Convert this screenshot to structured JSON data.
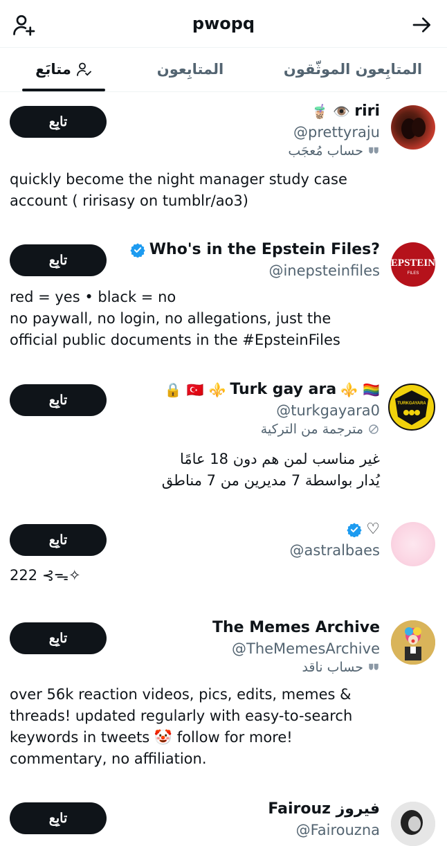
{
  "header": {
    "title": "pwopq",
    "add_user_icon": "add-user-icon",
    "forward_icon": "arrow-right-icon"
  },
  "tabs": [
    {
      "label": "المتابِعون الموثّقون",
      "active": false
    },
    {
      "label": "المتابِعون",
      "active": false
    },
    {
      "label": "متابَع",
      "active": true
    }
  ],
  "colors": {
    "primary_text": "#0f1419",
    "secondary_text": "#536471",
    "verified": "#1d9bf0",
    "button": "#0f1419"
  },
  "users": [
    {
      "name": "riri",
      "name_emoji": "🧋 👁️",
      "handle": "@prettyraju",
      "label": "حساب مُعجَب",
      "follow_label": "تابِع",
      "bio_lines": [
        "quickly become the night manager study case",
        "account ( ririsasy on tumblr/ao3)"
      ]
    },
    {
      "name": "Who's in the Epstein Files?",
      "handle": "@inepsteinfiles",
      "follow_label": "تابِع",
      "verified": true,
      "avatar_text": "EPSTEIN",
      "avatar_subtext": "FILES",
      "bio_lines": [
        "red = yes • black = no",
        "no paywall, no login, no allegations, just the",
        "official public documents in the #EpsteinFiles"
      ]
    },
    {
      "name": "Turk gay ara",
      "name_prefix": "🔒 🇹🇷 ⚜️",
      "name_suffix": "⚜️ 🏳️‍🌈",
      "handle": "@turkgayara0",
      "label": "مترجمة من التركية",
      "follow_label": "تابِع",
      "avatar_text": "TURKGAYARA",
      "bio_lines": [
        "غير مناسب لمن هم دون 18 عامًا",
        "يُدار بواسطة 7 مديرين من 7 مناطق"
      ]
    },
    {
      "name": "♡",
      "handle": "@astralbaes",
      "follow_label": "تابِع",
      "verified": true,
      "bio_lines": [
        "222 ⊰ᯓ✧"
      ]
    },
    {
      "name": "The Memes Archive",
      "handle": "@TheMemesArchive",
      "label": "حساب ناقد",
      "follow_label": "تابِع",
      "bio_lines": [
        "over 56k reaction videos, pics, edits, memes &",
        "threads! updated regularly with easy-to-search",
        "keywords in tweets 🤡 follow for more!",
        "commentary, no affiliation."
      ]
    },
    {
      "name": "Fairouz فيروز",
      "handle": "@Fairouzna",
      "follow_label": "تابِع"
    }
  ]
}
